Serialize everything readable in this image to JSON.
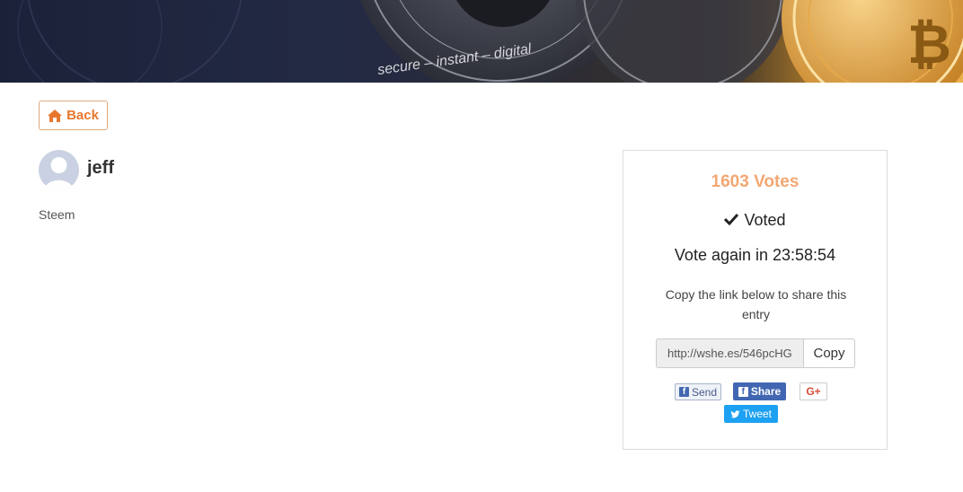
{
  "banner": {
    "coin_texts": [
      "secure",
      "instant",
      "digital"
    ]
  },
  "back_button": {
    "label": "Back"
  },
  "entry": {
    "user_name": "jeff",
    "category": "Steem"
  },
  "vote_card": {
    "votes": "1603 Votes",
    "voted_label": "Voted",
    "vote_again": "Vote again in 23:58:54",
    "share_note": "Copy the link below to share this entry",
    "share_link": "http://wshe.es/546pcHG",
    "copy_label": "Copy",
    "social": {
      "fb_send": "Send",
      "fb_share": "Share",
      "gplus": "G+",
      "tweet": "Tweet"
    }
  },
  "colors": {
    "accent": "#e8772e",
    "votes": "#f2a772",
    "facebook": "#4267b2",
    "twitter": "#1da1f2",
    "gplus": "#dd4b39"
  }
}
